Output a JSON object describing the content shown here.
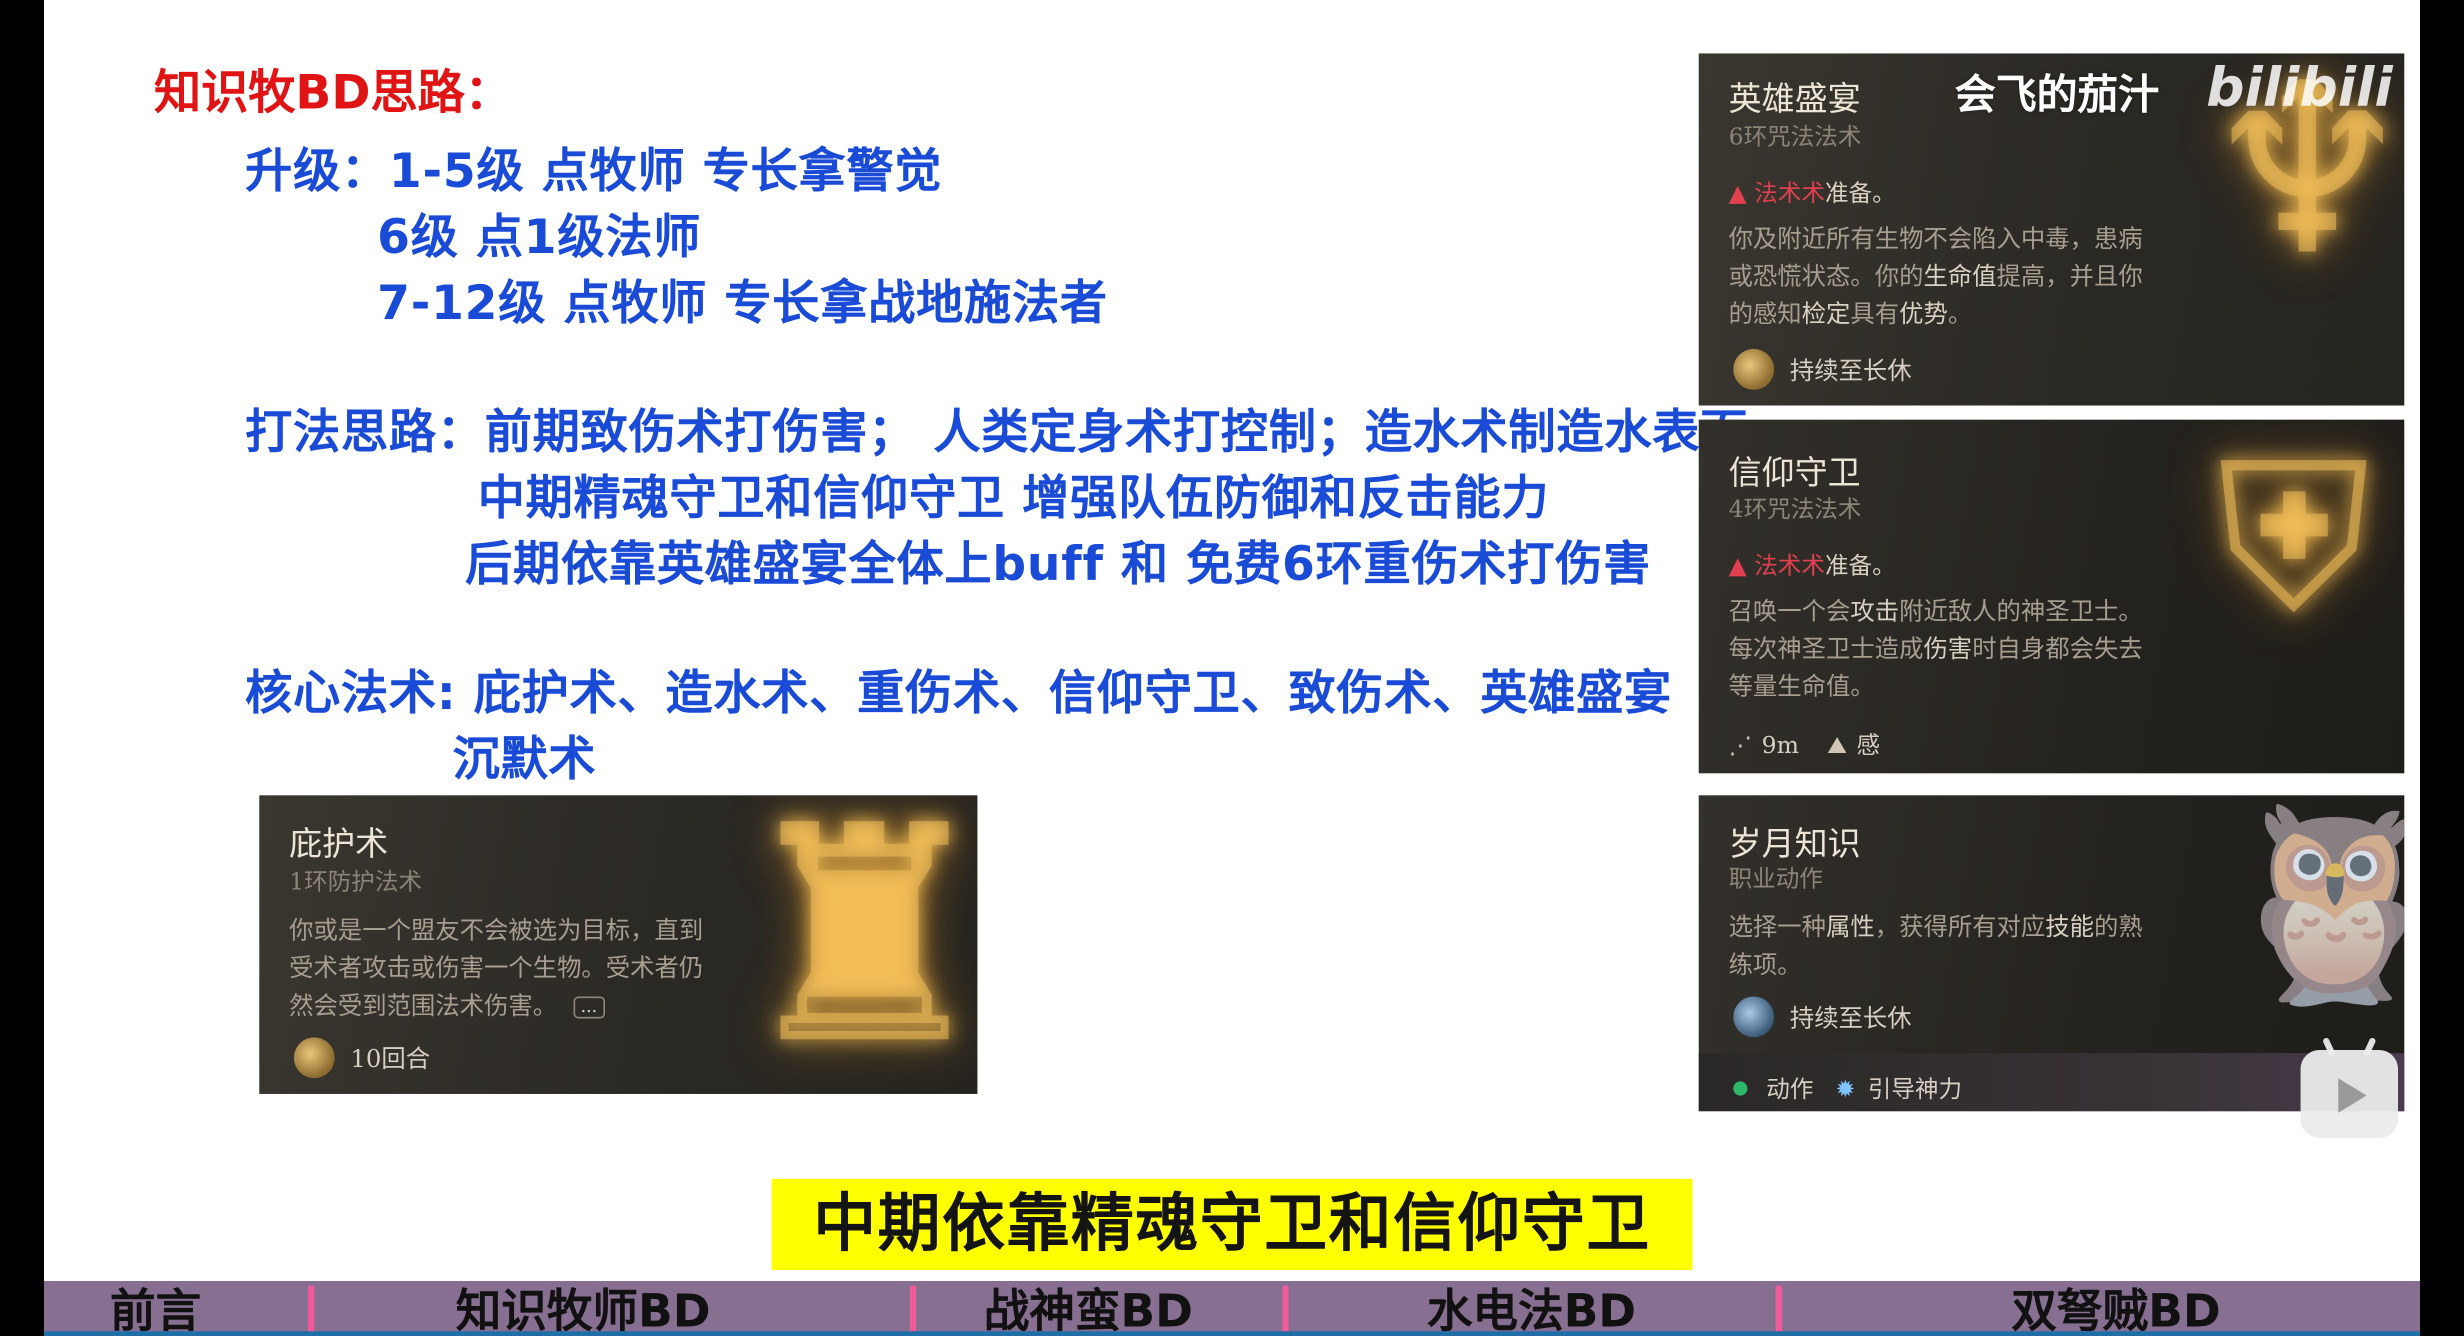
{
  "slide": {
    "heading": "知识牧BD思路：",
    "upgrade": {
      "label": "升级：",
      "lines": [
        "1-5级 点牧师 专长拿警觉",
        "6级 点1级法师",
        "7-12级 点牧师 专长拿战地施法者"
      ]
    },
    "strategy": {
      "label": "打法思路：",
      "lines": [
        "前期致伤术打伤害； 人类定身术打控制；造水术制造水表面",
        "中期精魂守卫和信仰守卫 增强队伍防御和反击能力",
        "后期依靠英雄盛宴全体上buff  和 免费6环重伤术打伤害"
      ]
    },
    "core": {
      "label": "核心法术:",
      "lines": [
        "庇护术、造水术、重伤术、信仰守卫、致伤术、英雄盛宴",
        "沉默术"
      ]
    }
  },
  "cards": {
    "sanctuary": {
      "title": "庇护术",
      "subtitle": "1环防护法术",
      "desc_lines": [
        "你或是一个盟友不会被选为目标，直到",
        "受术者攻击或伤害一个生物。受术者仍",
        "然会受到范围法术伤害。"
      ],
      "more": "...",
      "duration": "10回合",
      "icon": "sanctuary-icon"
    },
    "heroes_feast": {
      "title": "英雄盛宴",
      "subtitle": "6环咒法法术",
      "warn_red": "法术术",
      "warn_rest": "准备。",
      "desc_1": "你及附近所有生物不会陷入中毒，患病",
      "desc_2a": "或恐慌状态。你的",
      "desc_2b": "生命值",
      "desc_2c": "提高，并且你",
      "desc_3a": "的感知",
      "desc_3b": "检定",
      "desc_3c": "具有",
      "desc_3d": "优势",
      "desc_3e": "。",
      "duration": "持续至长休"
    },
    "guardian_of_faith": {
      "title": "信仰守卫",
      "subtitle": "4环咒法法术",
      "warn_red": "法术术",
      "warn_rest": "准备。",
      "desc_1a": "召唤一个会",
      "desc_1b": "攻击",
      "desc_1c": "附近敌人的神圣卫士。",
      "desc_2a": "每次神圣卫士造成",
      "desc_2b": "伤害",
      "desc_2c": "时自身都会失去",
      "desc_3": "等量生命值。",
      "range": "9m",
      "sense": "感"
    },
    "knowledge_of_ages": {
      "title": "岁月知识",
      "subtitle": "职业动作",
      "desc_1a": "选择一种",
      "desc_1b": "属性",
      "desc_1c": "，获得所有对应",
      "desc_1d": "技能",
      "desc_1e": "的熟",
      "desc_2": "练项。",
      "duration": "持续至长休",
      "cost_action": "动作",
      "cost_channel": "引导神力"
    }
  },
  "watermark": {
    "author": "会飞的茄汁",
    "logo": "bilibili"
  },
  "subtitle": "中期依靠精魂守卫和信仰守卫",
  "chapters": [
    "前言",
    "知识牧师BD",
    "战神蛮BD",
    "水电法BD",
    "双弩贼BD"
  ],
  "colors": {
    "heading_red": "#e01414",
    "body_blue": "#1a4bd6",
    "subtitle_yellow": "#ffff00",
    "chapter_bar": "#876f92",
    "chapter_separator": "#f05b9a"
  }
}
